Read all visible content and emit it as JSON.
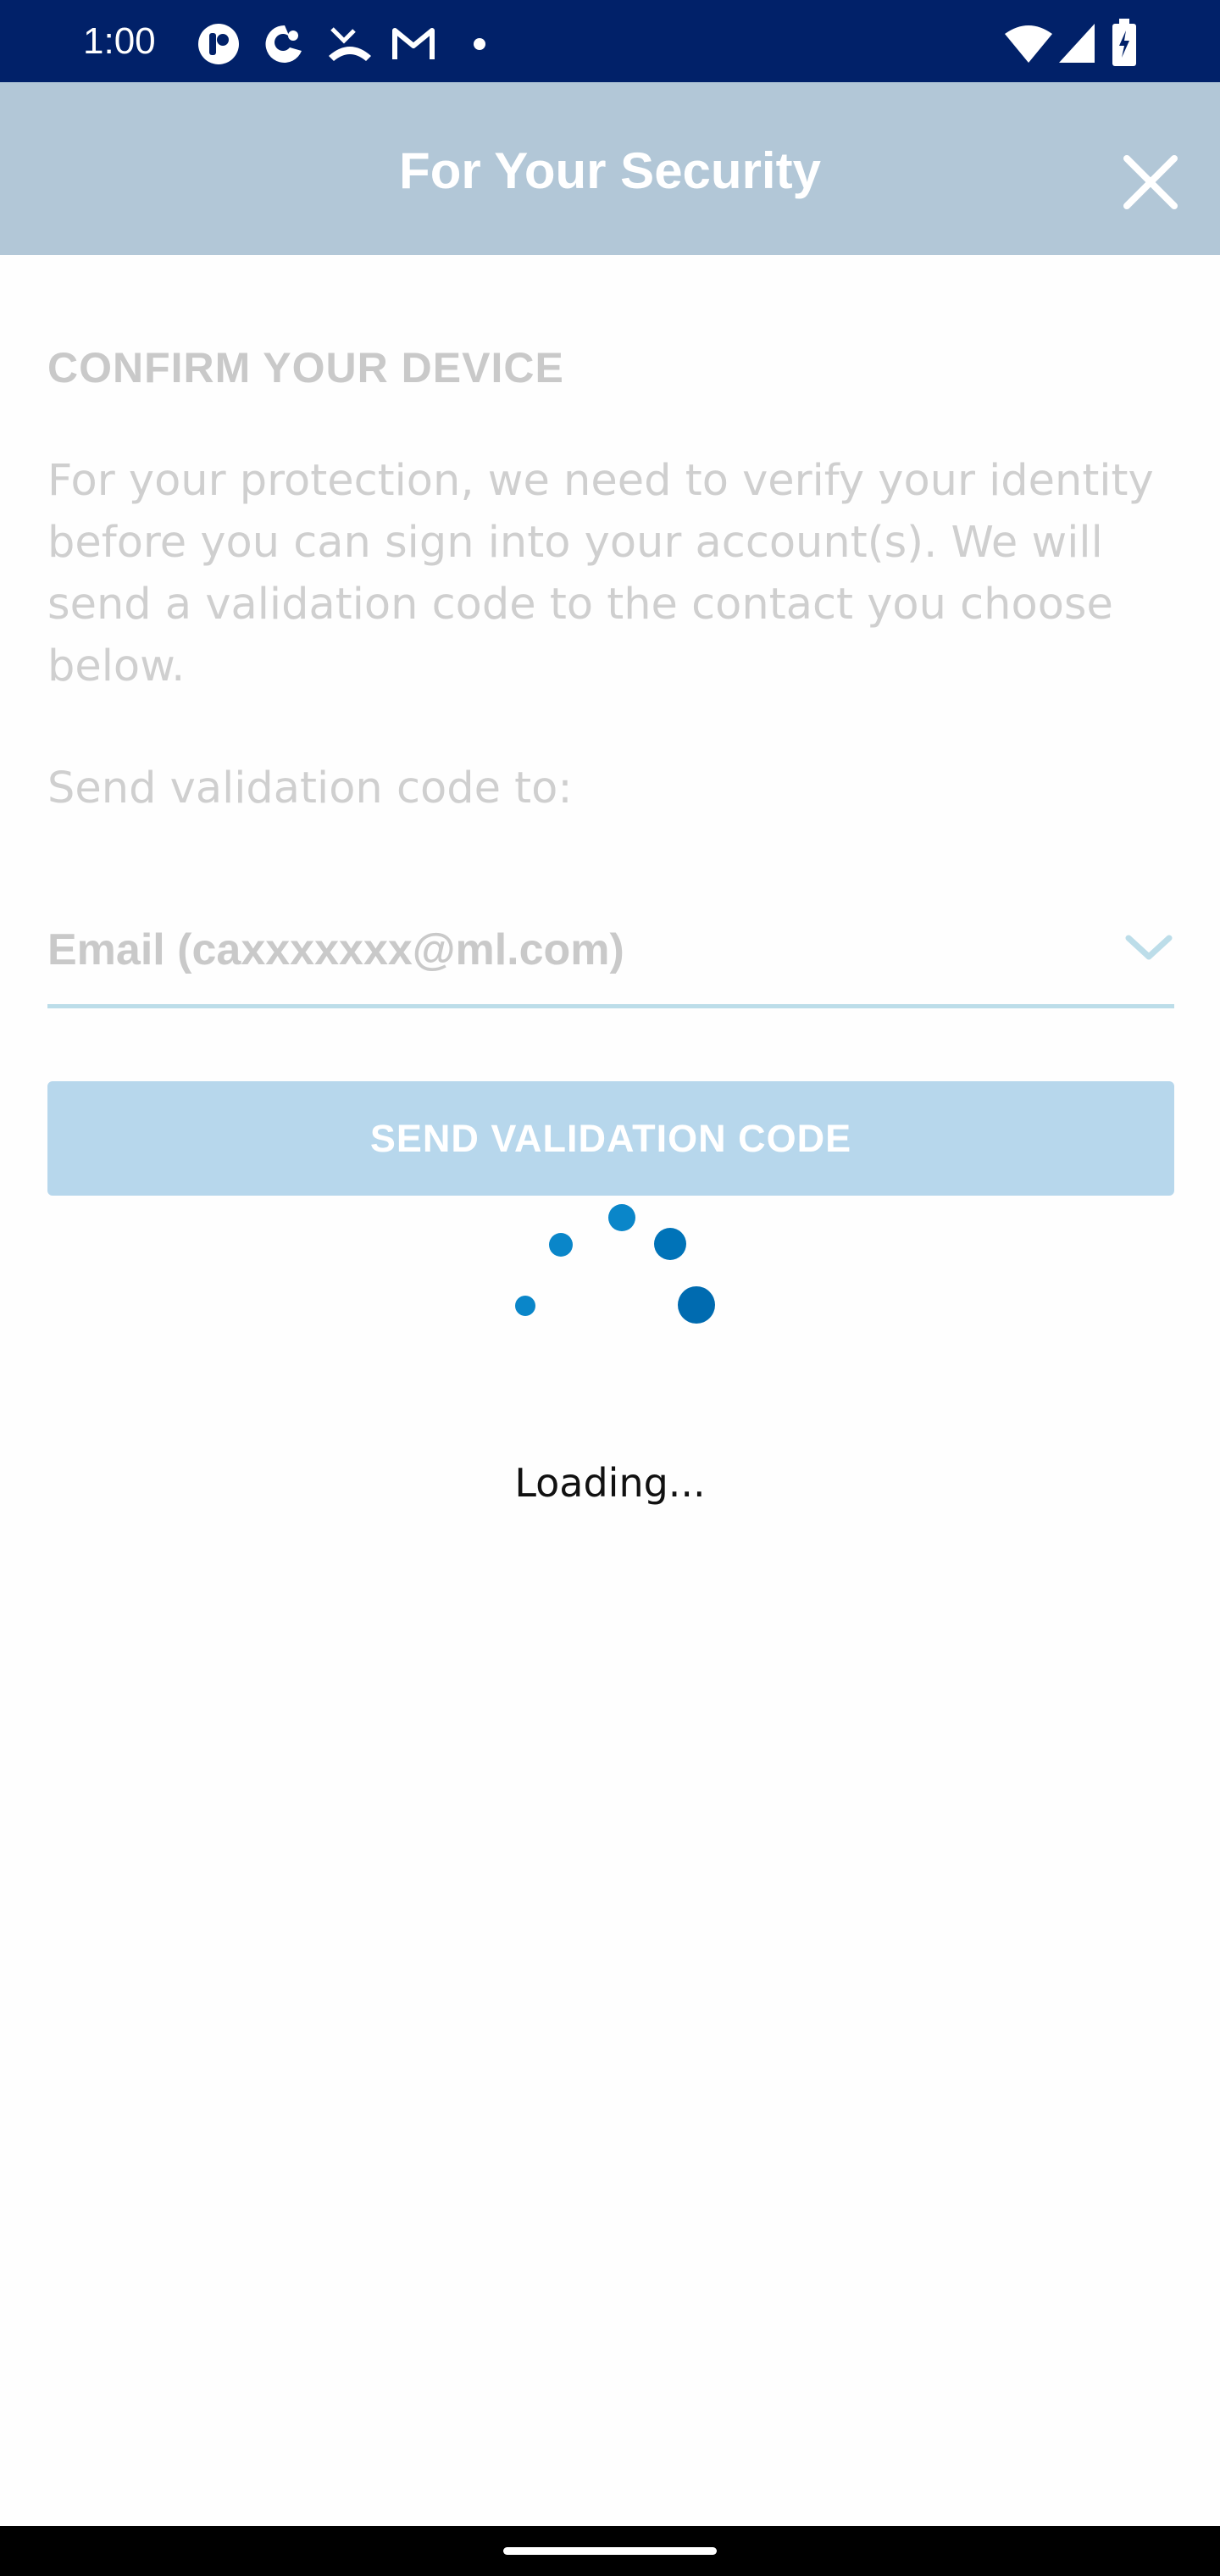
{
  "status_bar": {
    "time": "1:00",
    "icons": [
      "app-notification-icon",
      "app-notification-icon-2",
      "missed-call-icon",
      "gmail-icon",
      "dot-icon",
      "wifi-icon",
      "cell-signal-icon",
      "battery-icon"
    ],
    "background": "#012169"
  },
  "header": {
    "title": "For Your Security",
    "close_icon": "close-icon",
    "background": "#b2c7d7"
  },
  "form": {
    "section_title": "CONFIRM YOUR DEVICE",
    "intro_text": "For your protection, we need to verify your identity before you can sign into your account(s). We will send a validation code to the contact you choose below.",
    "send_label": "Send validation code to:",
    "selected_contact": "Email (caxxxxxxx@ml.com)",
    "dropdown_icon": "chevron-down-icon",
    "send_button_label": "SEND VALIDATION CODE",
    "button_color": "#b7d7ec"
  },
  "loading": {
    "text": "Loading...",
    "spinner_colors": [
      "#0a86c9",
      "#0073b8",
      "#006bb0"
    ]
  }
}
